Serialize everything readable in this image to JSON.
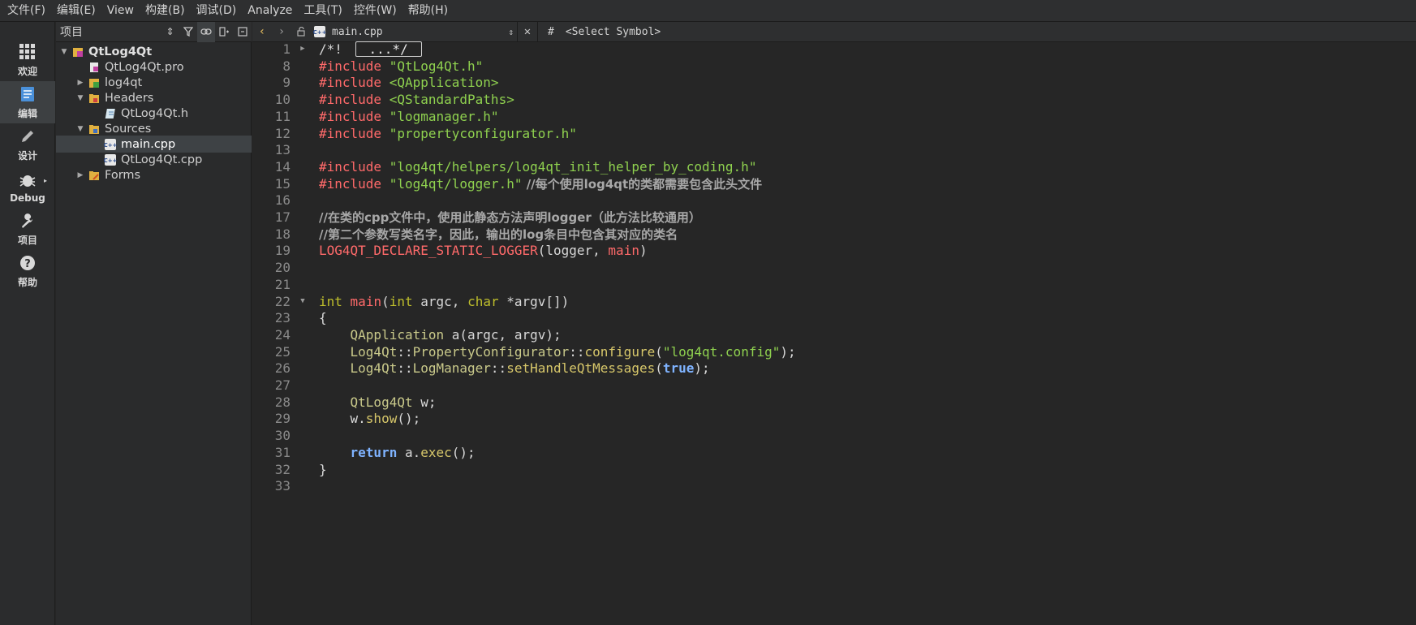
{
  "menubar": {
    "items": [
      "文件(F)",
      "编辑(E)",
      "View",
      "构建(B)",
      "调试(D)",
      "Analyze",
      "工具(T)",
      "控件(W)",
      "帮助(H)"
    ]
  },
  "modes": [
    {
      "label": "欢迎",
      "icon": "grid-icon"
    },
    {
      "label": "编辑",
      "icon": "document-edit-icon"
    },
    {
      "label": "设计",
      "icon": "pencil-icon"
    },
    {
      "label": "Debug",
      "icon": "bug-icon"
    },
    {
      "label": "项目",
      "icon": "wrench-icon"
    },
    {
      "label": "帮助",
      "icon": "help-circle-icon"
    }
  ],
  "project_pane": {
    "title": "项目",
    "tree": [
      {
        "label": "QtLog4Qt",
        "depth": 0,
        "expanded": true,
        "bold": true,
        "icon": "project-icon"
      },
      {
        "label": "QtLog4Qt.pro",
        "depth": 1,
        "icon": "pro-file-icon"
      },
      {
        "label": "log4qt",
        "depth": 1,
        "expanded": false,
        "icon": "subproject-icon"
      },
      {
        "label": "Headers",
        "depth": 1,
        "expanded": true,
        "icon": "headers-folder-icon"
      },
      {
        "label": "QtLog4Qt.h",
        "depth": 2,
        "icon": "header-file-icon"
      },
      {
        "label": "Sources",
        "depth": 1,
        "expanded": true,
        "icon": "sources-folder-icon"
      },
      {
        "label": "main.cpp",
        "depth": 2,
        "selected": true,
        "icon": "cpp-file-icon"
      },
      {
        "label": "QtLog4Qt.cpp",
        "depth": 2,
        "icon": "cpp-file-icon"
      },
      {
        "label": "Forms",
        "depth": 1,
        "expanded": false,
        "icon": "forms-folder-icon"
      }
    ]
  },
  "editor_toolbar": {
    "file_name": "main.cpp",
    "hash": "#",
    "symbol_placeholder": "<Select Symbol>"
  },
  "editor": {
    "lines": [
      {
        "n": "1",
        "fold": "closed",
        "tokens": [
          {
            "t": "/*! ",
            "c": "t-plain"
          },
          {
            "t": "...*/",
            "c": "fold-box"
          }
        ]
      },
      {
        "n": "8",
        "tokens": [
          {
            "t": "#include ",
            "c": "t-pre"
          },
          {
            "t": "\"QtLog4Qt.h\"",
            "c": "t-str"
          }
        ]
      },
      {
        "n": "9",
        "tokens": [
          {
            "t": "#include ",
            "c": "t-pre"
          },
          {
            "t": "<QApplication>",
            "c": "t-str"
          }
        ]
      },
      {
        "n": "10",
        "tokens": [
          {
            "t": "#include ",
            "c": "t-pre"
          },
          {
            "t": "<QStandardPaths>",
            "c": "t-str"
          }
        ]
      },
      {
        "n": "11",
        "tokens": [
          {
            "t": "#include ",
            "c": "t-pre"
          },
          {
            "t": "\"logmanager.h\"",
            "c": "t-str"
          }
        ]
      },
      {
        "n": "12",
        "tokens": [
          {
            "t": "#include ",
            "c": "t-pre"
          },
          {
            "t": "\"propertyconfigurator.h\"",
            "c": "t-str"
          }
        ]
      },
      {
        "n": "13",
        "tokens": []
      },
      {
        "n": "14",
        "tokens": [
          {
            "t": "#include ",
            "c": "t-pre"
          },
          {
            "t": "\"log4qt/helpers/log4qt_init_helper_by_coding.h\"",
            "c": "t-str"
          }
        ]
      },
      {
        "n": "15",
        "tokens": [
          {
            "t": "#include ",
            "c": "t-pre"
          },
          {
            "t": "\"log4qt/logger.h\"",
            "c": "t-str"
          },
          {
            "t": " //每个使用log4qt的类都需要包含此头文件",
            "c": "t-cm"
          }
        ]
      },
      {
        "n": "16",
        "tokens": []
      },
      {
        "n": "17",
        "tokens": [
          {
            "t": "//在类的cpp文件中，使用此静态方法声明logger（此方法比较通用）",
            "c": "t-cm"
          }
        ]
      },
      {
        "n": "18",
        "tokens": [
          {
            "t": "//第二个参数写类名字，因此，输出的log条目中包含其对应的类名",
            "c": "t-cm"
          }
        ]
      },
      {
        "n": "19",
        "tokens": [
          {
            "t": "LOG4QT_DECLARE_STATIC_LOGGER",
            "c": "t-mac"
          },
          {
            "t": "(logger, ",
            "c": "t-plain"
          },
          {
            "t": "main",
            "c": "t-mac"
          },
          {
            "t": ")",
            "c": "t-plain"
          }
        ]
      },
      {
        "n": "20",
        "tokens": []
      },
      {
        "n": "21",
        "tokens": []
      },
      {
        "n": "22",
        "fold": "open",
        "tokens": [
          {
            "t": "int",
            "c": "t-kw"
          },
          {
            "t": " ",
            "c": "t-plain"
          },
          {
            "t": "main",
            "c": "t-mac"
          },
          {
            "t": "(",
            "c": "t-plain"
          },
          {
            "t": "int",
            "c": "t-kw"
          },
          {
            "t": " argc, ",
            "c": "t-plain"
          },
          {
            "t": "char",
            "c": "t-kw"
          },
          {
            "t": " *argv[])",
            "c": "t-plain"
          }
        ]
      },
      {
        "n": "23",
        "tokens": [
          {
            "t": "{",
            "c": "t-plain"
          }
        ]
      },
      {
        "n": "24",
        "tokens": [
          {
            "t": "    ",
            "c": "t-plain"
          },
          {
            "t": "QApplication",
            "c": "t-ty"
          },
          {
            "t": " a(argc, argv);",
            "c": "t-plain"
          }
        ]
      },
      {
        "n": "25",
        "tokens": [
          {
            "t": "    ",
            "c": "t-plain"
          },
          {
            "t": "Log4Qt",
            "c": "t-ns"
          },
          {
            "t": "::",
            "c": "t-plain"
          },
          {
            "t": "PropertyConfigurator",
            "c": "t-ty"
          },
          {
            "t": "::",
            "c": "t-plain"
          },
          {
            "t": "configure",
            "c": "t-fn"
          },
          {
            "t": "(",
            "c": "t-plain"
          },
          {
            "t": "\"log4qt.config\"",
            "c": "t-str"
          },
          {
            "t": ");",
            "c": "t-plain"
          }
        ]
      },
      {
        "n": "26",
        "tokens": [
          {
            "t": "    ",
            "c": "t-plain"
          },
          {
            "t": "Log4Qt",
            "c": "t-ns"
          },
          {
            "t": "::",
            "c": "t-plain"
          },
          {
            "t": "LogManager",
            "c": "t-ty"
          },
          {
            "t": "::",
            "c": "t-plain"
          },
          {
            "t": "setHandleQtMessages",
            "c": "t-fn"
          },
          {
            "t": "(",
            "c": "t-plain"
          },
          {
            "t": "true",
            "c": "t-kwb"
          },
          {
            "t": ");",
            "c": "t-plain"
          }
        ]
      },
      {
        "n": "27",
        "tokens": []
      },
      {
        "n": "28",
        "tokens": [
          {
            "t": "    ",
            "c": "t-plain"
          },
          {
            "t": "QtLog4Qt",
            "c": "t-ty"
          },
          {
            "t": " w;",
            "c": "t-plain"
          }
        ]
      },
      {
        "n": "29",
        "tokens": [
          {
            "t": "    w.",
            "c": "t-plain"
          },
          {
            "t": "show",
            "c": "t-fn"
          },
          {
            "t": "();",
            "c": "t-plain"
          }
        ]
      },
      {
        "n": "30",
        "tokens": []
      },
      {
        "n": "31",
        "tokens": [
          {
            "t": "    ",
            "c": "t-plain"
          },
          {
            "t": "return",
            "c": "t-kwb"
          },
          {
            "t": " a.",
            "c": "t-plain"
          },
          {
            "t": "exec",
            "c": "t-fn"
          },
          {
            "t": "();",
            "c": "t-plain"
          }
        ]
      },
      {
        "n": "32",
        "tokens": [
          {
            "t": "}",
            "c": "t-plain"
          }
        ]
      },
      {
        "n": "33",
        "tokens": []
      }
    ]
  }
}
